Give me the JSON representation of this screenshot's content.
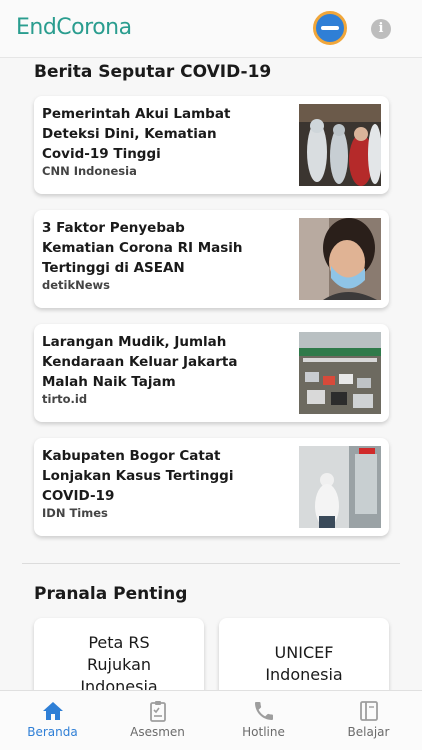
{
  "header": {
    "app_name": "EndCorona",
    "info_glyph": "i",
    "colors": {
      "brand": "#2a9d8f",
      "lang_button": "#2f7fd6",
      "lang_ring": "#f0a63a"
    }
  },
  "news_section": {
    "title": "Berita Seputar COVID-19",
    "items": [
      {
        "title": "Pemerintah Akui Lambat Deteksi Dini, Kematian Covid-19 Tinggi",
        "source": "CNN Indonesia",
        "image": "medical-workers-photo"
      },
      {
        "title": "3 Faktor Penyebab Kematian Corona RI Masih Tertinggi di ASEAN",
        "source": "detikNews",
        "image": "masked-woman-photo"
      },
      {
        "title": "Larangan Mudik, Jumlah Kendaraan Keluar Jakarta Malah Naik Tajam",
        "source": "tirto.id",
        "image": "toll-gate-traffic-photo"
      },
      {
        "title": "Kabupaten Bogor Catat Lonjakan Kasus Tertinggi COVID-19",
        "source": "IDN Times",
        "image": "hazmat-worker-photo"
      }
    ]
  },
  "links_section": {
    "title": "Pranala Penting",
    "items": [
      {
        "label": "Peta RS Rujukan Indonesia"
      },
      {
        "label": "UNICEF Indonesia"
      }
    ]
  },
  "bottom_nav": {
    "items": [
      {
        "label": "Beranda",
        "icon": "home-icon",
        "active": true
      },
      {
        "label": "Asesmen",
        "icon": "clipboard-icon",
        "active": false
      },
      {
        "label": "Hotline",
        "icon": "phone-icon",
        "active": false
      },
      {
        "label": "Belajar",
        "icon": "book-icon",
        "active": false
      }
    ],
    "colors": {
      "active": "#2f7fd6",
      "inactive": "#9e9e9e"
    }
  }
}
